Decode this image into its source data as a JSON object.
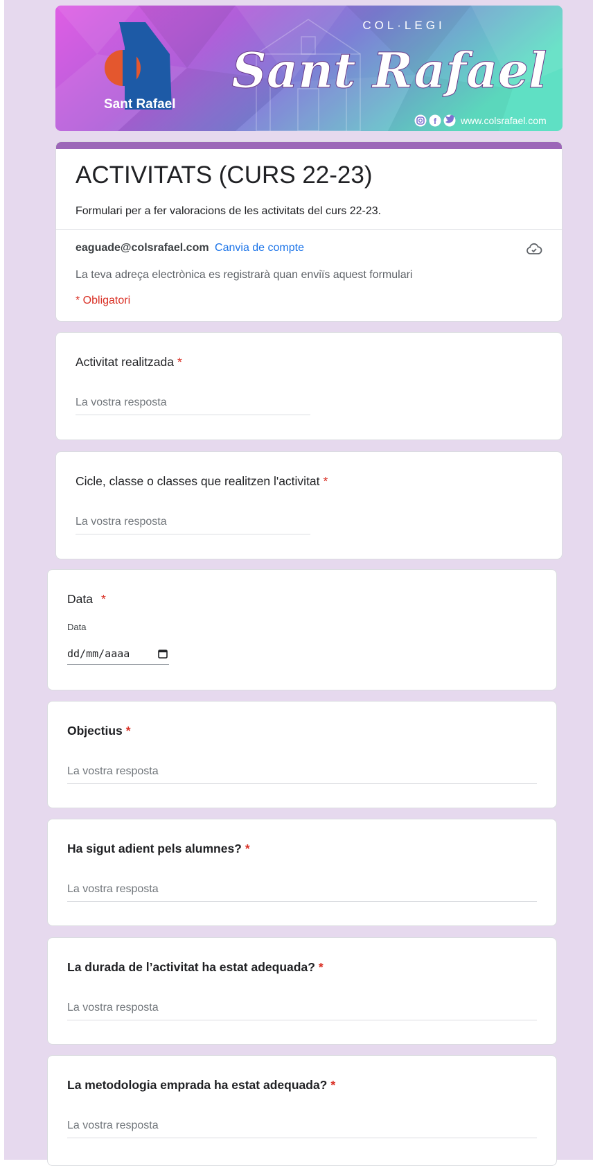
{
  "banner": {
    "small_caption": "COL·LEGI",
    "title": "Sant Rafael",
    "logo_text": "Sant Rafael",
    "website": "www.colsrafael.com",
    "social_icons": [
      "instagram-icon",
      "facebook-icon",
      "twitter-icon"
    ],
    "colors": {
      "pink": "#e063e6",
      "purple": "#7a6fd1",
      "teal": "#5fd9c6",
      "logo_blue": "#1d5aa6",
      "logo_orange": "#e4572e"
    }
  },
  "form": {
    "accent_color": "#9c67b8",
    "title": "ACTIVITATS (CURS 22-23)",
    "description": "Formulari per a fer valoracions de les activitats del curs 22-23.",
    "account_email": "eaguade@colsrafael.com",
    "switch_account": "Canvia de compte",
    "email_note": "La teva adreça electrònica es registrarà quan enviïs aquest formulari",
    "required_note": "* Obligatori"
  },
  "questions": [
    {
      "label": "Activitat realitzada",
      "required": "*",
      "placeholder": "La vostra resposta"
    },
    {
      "label": "Cicle, classe o classes que realitzen l'activitat",
      "required": "*",
      "placeholder": "La vostra resposta"
    },
    {
      "label": "Data",
      "required": "*",
      "sublabel": "Data",
      "value": "dd/mm/aaaa"
    },
    {
      "label": "Objectius",
      "required": "*",
      "placeholder": "La vostra resposta"
    },
    {
      "label": "Ha sigut adient pels alumnes?",
      "required": "*",
      "placeholder": "La vostra resposta"
    },
    {
      "label": "La durada de l’activitat ha estat adequada?",
      "required": "*",
      "placeholder": "La vostra resposta"
    },
    {
      "label": "La metodologia emprada ha estat adequada?",
      "required": "*",
      "placeholder": "La vostra resposta"
    }
  ]
}
